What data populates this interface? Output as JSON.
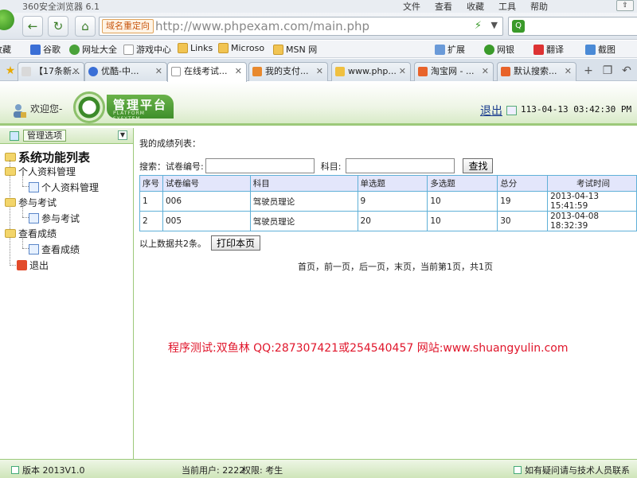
{
  "browser": {
    "title": "360安全浏览器 6.1",
    "menus": [
      "文件",
      "查看",
      "收藏",
      "工具",
      "帮助"
    ],
    "address": {
      "redirect_tag": "域名重定向",
      "url": "http://www.phpexam.com/main.php"
    },
    "bookmarks": [
      "收藏",
      "谷歌",
      "网址大全",
      "游戏中心",
      "Links",
      "Microso",
      "MSN 网",
      "扩展",
      "网银",
      "翻译",
      "截图"
    ],
    "tabs": [
      "【17条新...",
      "优酷-中...",
      "在线考试...",
      "我的支付...",
      "www.php...",
      "淘宝网 - ...",
      "默认搜索..."
    ],
    "active_tab": 2
  },
  "header": {
    "welcome": "欢迎您-",
    "banner_title": "管理平台",
    "banner_subtitle": "PLATFORM SYSYTEM",
    "logout": "退出",
    "datetime": "113-04-13 03:42:30 PM"
  },
  "sidebar": {
    "toolbar_label": "管理选项",
    "root": "系统功能列表",
    "groups": [
      {
        "label": "个人资料管理",
        "child": "个人资料管理"
      },
      {
        "label": "参与考试",
        "child": "参与考试"
      },
      {
        "label": "查看成绩",
        "child": "查看成绩"
      }
    ],
    "exit": "退出"
  },
  "main": {
    "heading": "我的成绩列表：",
    "search": {
      "label": "搜索：试卷编号:",
      "subject_label": "科目:",
      "paper_value": "",
      "subject_value": "",
      "button": "查找"
    },
    "table": {
      "headers": [
        "序号",
        "试卷编号",
        "科目",
        "单选题",
        "多选题",
        "总分",
        "考试时间"
      ],
      "rows": [
        [
          "1",
          "006",
          "驾驶员理论",
          "9",
          "10",
          "19",
          "2013-04-13 15:41:59"
        ],
        [
          "2",
          "005",
          "驾驶员理论",
          "20",
          "10",
          "30",
          "2013-04-08 18:32:39"
        ]
      ]
    },
    "summary": "以上数据共2条。",
    "print_button": "打印本页",
    "pager": "首页，前一页，后一页，末页，当前第1页，共1页",
    "watermark": "程序测试:双鱼林 QQ:287307421或254540457 网站:www.shuangyulin.com"
  },
  "status": {
    "version": "版本 2013V1.0",
    "user": "当前用户: 2222",
    "role": "权限:   考生",
    "contact": "如有疑问请与技术人员联系"
  }
}
